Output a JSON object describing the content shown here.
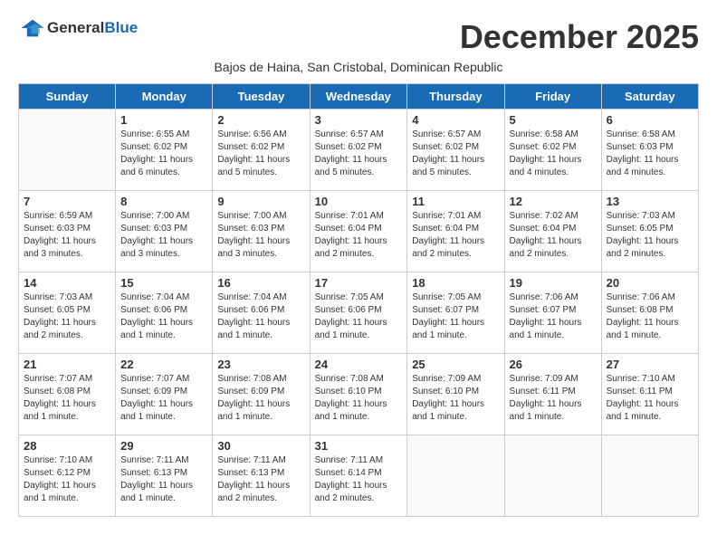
{
  "logo": {
    "text_general": "General",
    "text_blue": "Blue"
  },
  "title": "December 2025",
  "subtitle": "Bajos de Haina, San Cristobal, Dominican Republic",
  "days_header": [
    "Sunday",
    "Monday",
    "Tuesday",
    "Wednesday",
    "Thursday",
    "Friday",
    "Saturday"
  ],
  "weeks": [
    [
      {
        "day": "",
        "info": ""
      },
      {
        "day": "1",
        "info": "Sunrise: 6:55 AM\nSunset: 6:02 PM\nDaylight: 11 hours\nand 6 minutes."
      },
      {
        "day": "2",
        "info": "Sunrise: 6:56 AM\nSunset: 6:02 PM\nDaylight: 11 hours\nand 5 minutes."
      },
      {
        "day": "3",
        "info": "Sunrise: 6:57 AM\nSunset: 6:02 PM\nDaylight: 11 hours\nand 5 minutes."
      },
      {
        "day": "4",
        "info": "Sunrise: 6:57 AM\nSunset: 6:02 PM\nDaylight: 11 hours\nand 5 minutes."
      },
      {
        "day": "5",
        "info": "Sunrise: 6:58 AM\nSunset: 6:02 PM\nDaylight: 11 hours\nand 4 minutes."
      },
      {
        "day": "6",
        "info": "Sunrise: 6:58 AM\nSunset: 6:03 PM\nDaylight: 11 hours\nand 4 minutes."
      }
    ],
    [
      {
        "day": "7",
        "info": "Sunrise: 6:59 AM\nSunset: 6:03 PM\nDaylight: 11 hours\nand 3 minutes."
      },
      {
        "day": "8",
        "info": "Sunrise: 7:00 AM\nSunset: 6:03 PM\nDaylight: 11 hours\nand 3 minutes."
      },
      {
        "day": "9",
        "info": "Sunrise: 7:00 AM\nSunset: 6:03 PM\nDaylight: 11 hours\nand 3 minutes."
      },
      {
        "day": "10",
        "info": "Sunrise: 7:01 AM\nSunset: 6:04 PM\nDaylight: 11 hours\nand 2 minutes."
      },
      {
        "day": "11",
        "info": "Sunrise: 7:01 AM\nSunset: 6:04 PM\nDaylight: 11 hours\nand 2 minutes."
      },
      {
        "day": "12",
        "info": "Sunrise: 7:02 AM\nSunset: 6:04 PM\nDaylight: 11 hours\nand 2 minutes."
      },
      {
        "day": "13",
        "info": "Sunrise: 7:03 AM\nSunset: 6:05 PM\nDaylight: 11 hours\nand 2 minutes."
      }
    ],
    [
      {
        "day": "14",
        "info": "Sunrise: 7:03 AM\nSunset: 6:05 PM\nDaylight: 11 hours\nand 2 minutes."
      },
      {
        "day": "15",
        "info": "Sunrise: 7:04 AM\nSunset: 6:06 PM\nDaylight: 11 hours\nand 1 minute."
      },
      {
        "day": "16",
        "info": "Sunrise: 7:04 AM\nSunset: 6:06 PM\nDaylight: 11 hours\nand 1 minute."
      },
      {
        "day": "17",
        "info": "Sunrise: 7:05 AM\nSunset: 6:06 PM\nDaylight: 11 hours\nand 1 minute."
      },
      {
        "day": "18",
        "info": "Sunrise: 7:05 AM\nSunset: 6:07 PM\nDaylight: 11 hours\nand 1 minute."
      },
      {
        "day": "19",
        "info": "Sunrise: 7:06 AM\nSunset: 6:07 PM\nDaylight: 11 hours\nand 1 minute."
      },
      {
        "day": "20",
        "info": "Sunrise: 7:06 AM\nSunset: 6:08 PM\nDaylight: 11 hours\nand 1 minute."
      }
    ],
    [
      {
        "day": "21",
        "info": "Sunrise: 7:07 AM\nSunset: 6:08 PM\nDaylight: 11 hours\nand 1 minute."
      },
      {
        "day": "22",
        "info": "Sunrise: 7:07 AM\nSunset: 6:09 PM\nDaylight: 11 hours\nand 1 minute."
      },
      {
        "day": "23",
        "info": "Sunrise: 7:08 AM\nSunset: 6:09 PM\nDaylight: 11 hours\nand 1 minute."
      },
      {
        "day": "24",
        "info": "Sunrise: 7:08 AM\nSunset: 6:10 PM\nDaylight: 11 hours\nand 1 minute."
      },
      {
        "day": "25",
        "info": "Sunrise: 7:09 AM\nSunset: 6:10 PM\nDaylight: 11 hours\nand 1 minute."
      },
      {
        "day": "26",
        "info": "Sunrise: 7:09 AM\nSunset: 6:11 PM\nDaylight: 11 hours\nand 1 minute."
      },
      {
        "day": "27",
        "info": "Sunrise: 7:10 AM\nSunset: 6:11 PM\nDaylight: 11 hours\nand 1 minute."
      }
    ],
    [
      {
        "day": "28",
        "info": "Sunrise: 7:10 AM\nSunset: 6:12 PM\nDaylight: 11 hours\nand 1 minute."
      },
      {
        "day": "29",
        "info": "Sunrise: 7:11 AM\nSunset: 6:13 PM\nDaylight: 11 hours\nand 1 minute."
      },
      {
        "day": "30",
        "info": "Sunrise: 7:11 AM\nSunset: 6:13 PM\nDaylight: 11 hours\nand 2 minutes."
      },
      {
        "day": "31",
        "info": "Sunrise: 7:11 AM\nSunset: 6:14 PM\nDaylight: 11 hours\nand 2 minutes."
      },
      {
        "day": "",
        "info": ""
      },
      {
        "day": "",
        "info": ""
      },
      {
        "day": "",
        "info": ""
      }
    ]
  ]
}
